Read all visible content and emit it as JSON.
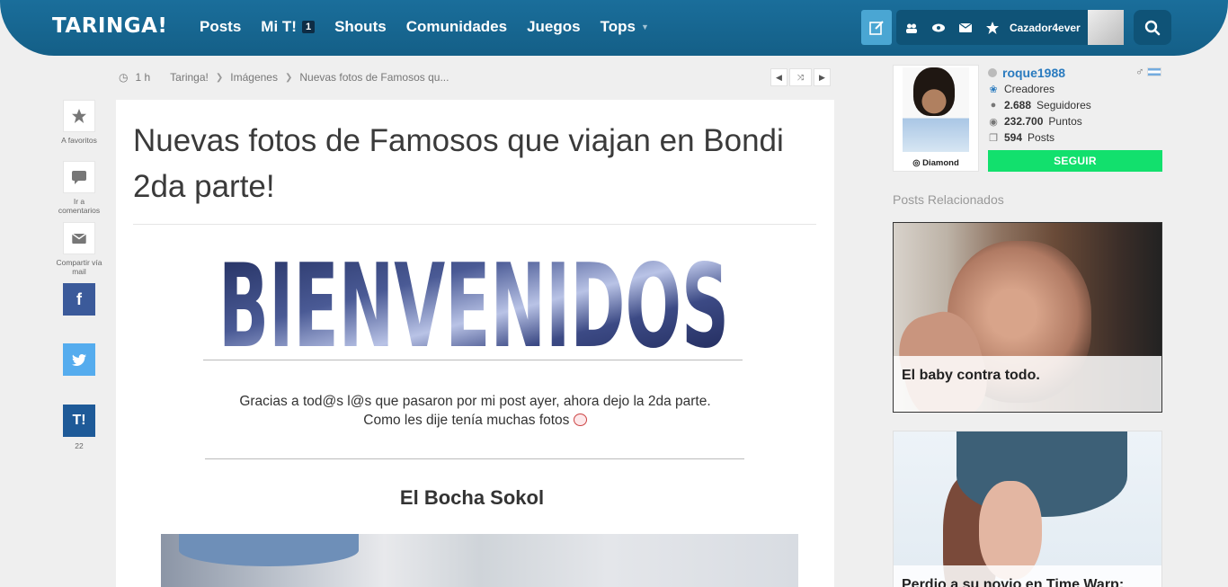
{
  "nav": {
    "logo": "TARINGA!",
    "menu": [
      {
        "label": "Posts"
      },
      {
        "label": "Mi T!",
        "badge": "1"
      },
      {
        "label": "Shouts"
      },
      {
        "label": "Comunidades"
      },
      {
        "label": "Juegos"
      },
      {
        "label": "Tops"
      }
    ],
    "username": "Cazador4ever",
    "icons": [
      "write-icon",
      "users-icon",
      "eye-icon",
      "mail-icon",
      "star-icon",
      "search-icon"
    ],
    "colors": {
      "bar": "#145f87",
      "accent": "#4aa6d3"
    }
  },
  "breadcrumb": {
    "time": "1 h",
    "items": [
      "Taringa!",
      "Imágenes",
      "Nuevas fotos de Famosos qu..."
    ]
  },
  "actions": {
    "favorites": "A favoritos",
    "comments": "Ir a comentarios",
    "share_mail": "Compartir vía mail",
    "taringa_count": "22",
    "taringa_label": "T!"
  },
  "post": {
    "title": "Nuevas fotos de Famosos que viajan en Bondi 2da parte!",
    "banner_text": "BIENVENIDOS",
    "intro_line1": "Gracias a tod@s l@s que pasaron por mi post ayer, ahora dejo la 2da parte.",
    "intro_line2": "Como les dije tenía muchas fotos",
    "section_title": "El Bocha Sokol"
  },
  "author": {
    "username": "roque1988",
    "rank": "Creadores",
    "followers": "2.688",
    "followers_label": "Seguidores",
    "points": "232.700",
    "points_label": "Puntos",
    "posts": "594",
    "posts_label": "Posts",
    "badge": "Diamond",
    "follow_label": "SEGUIR",
    "follow_color": "#12e06d"
  },
  "related": {
    "title": "Posts Relacionados",
    "items": [
      {
        "caption": "El baby contra todo."
      },
      {
        "caption": "Perdio a su novio en Time Warp:"
      }
    ]
  }
}
